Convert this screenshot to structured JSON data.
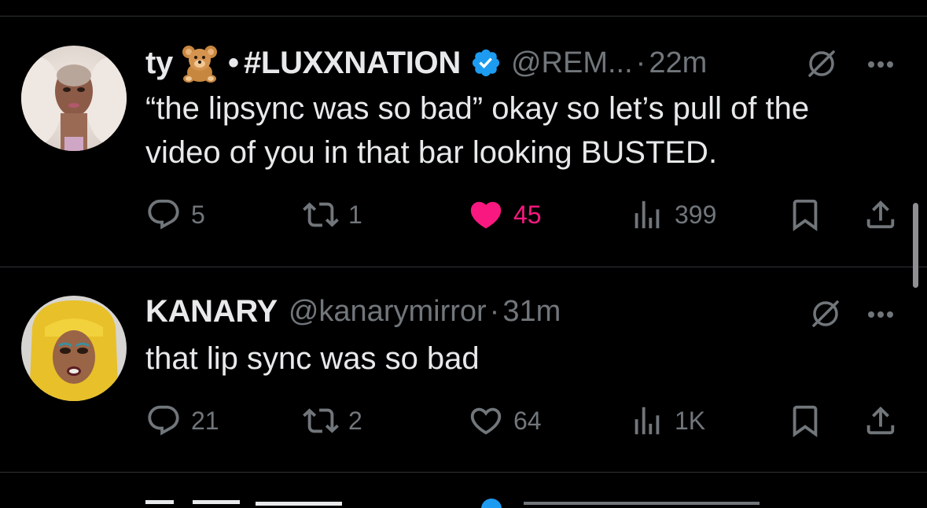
{
  "tweets": [
    {
      "display_name": "ty",
      "name_suffix": "#LUXXNATION",
      "bullet": "•",
      "handle": "@REM...",
      "dot": "·",
      "time": "22m",
      "text_line1": "“the lipsync was so bad” okay so let’s pull of the",
      "text_line2": "video of you in that bar looking BUSTED.",
      "replies": "5",
      "reposts": "1",
      "likes": "45",
      "views": "399",
      "liked": true
    },
    {
      "display_name": "KANARY",
      "handle": "@kanarymirror",
      "dot": "·",
      "time": "31m",
      "text_line1": "that lip sync was so bad",
      "replies": "21",
      "reposts": "2",
      "likes": "64",
      "views": "1K",
      "liked": false
    }
  ],
  "colors": {
    "background": "#000000",
    "text": "#e7e9ea",
    "muted": "#71767b",
    "like_pink": "#f91880",
    "verified_blue": "#1d9bf0",
    "divider": "#2f3336"
  },
  "icons": [
    "teddy-bear-emoji-icon",
    "verified-badge-icon",
    "grok-icon",
    "more-icon",
    "reply-icon",
    "repost-icon",
    "like-icon",
    "views-icon",
    "bookmark-icon",
    "share-icon"
  ]
}
